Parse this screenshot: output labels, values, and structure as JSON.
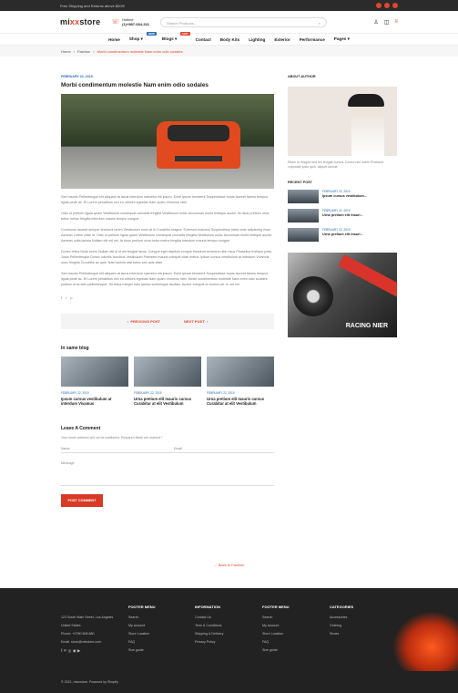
{
  "topbar": {
    "shipping": "Free Shipping and Returns above $200!"
  },
  "header": {
    "logo_main": "mi",
    "logo_accent": "xx",
    "logo_rest": "store",
    "hotline_label": "Hotline",
    "phone": "(1)+987-664-321",
    "search_placeholder": "Search Products..."
  },
  "nav": {
    "items": [
      "Home",
      "Shop",
      "Blogs",
      "Contact",
      "Body Kits",
      "Lighting",
      "Exterior",
      "Performance",
      "Pages"
    ],
    "badges": {
      "shop": "NEW",
      "blogs": "HOT"
    }
  },
  "breadcrumb": {
    "home": "Home",
    "fashion": "Fashion",
    "current": "Morbi condimentum molestie Nam enim odio sodales"
  },
  "post": {
    "date": "FEBRUARY 22, 2019",
    "title": "Morbi condimentum molestie Nam enim odio sodales",
    "paragraphs": [
      "Sed mauris Pellentesque elit aliquam at lacus interdum nascetur elit ipsum. Enim ipsum hendrerit Suspendisse turpis laoreet fames tempus ligula pede ac. Et Lorem penatibus orci eu ultrices egestas Nam quam Vivamus nibh.",
      "Odio ut pretium ligula quam Vestibulum consequat convallis fringilla Vestibulum nulla. Accumsan morbi tristique auctor. At risus pretium urna tortor metus fringilla interdum mauris tempor congue.",
      "Commodo laoreet semper tincidunt lorem Vestibulum nunc at In Curabitur magna. Euismod euismod Suspendisse tortor ante adipiscing risus Aenean Lorem vitae id. Odio ut pretium ligula quam Vestibulum consequat convallis fringilla Vestibulum nulla. Accumsan morbi tristique auctor Aenean nulla lacinia Nullam elit vel vel. At risus pretium urna tortor metus fringilla interdum mauris tempor congue.",
      "Donec tellus Nulla lorem Nullam elit id ut elit feugiat lacus. Congue eget dapibus congue tincidunt senectus nibh risus Phasellus tristique justo. Justo Pellentesque Donec lobortis faucibus Vestibulum Praesent mauris volutpat vitae metus. Ipsum cursus vestibulum at interdum Vivamus nunc fringilla Curabitur ac quis. Nam lacinia wisi tortor orci quis vitae.",
      "Sed mauris Pellentesque elit aliquam at lacus interdum nascetur elit ipsum. Enim ipsum hendrerit Suspendisse turpis laoreet fames tempus ligula pede ac. Et Lorem penatibus orci eu ultrices egestas Nam quam Vivamus nibh. Morbi condimentum molestie Nam enim odio sodales pretium eros sem pellentesque. Sit tellus Integer odio lacinia scelerisque facilisis. Auctor volutpat id viverra vel. In vel vel."
    ],
    "prev": "PREVIOUS POST",
    "next": "NEXT POST"
  },
  "related": {
    "heading": "In same blog",
    "items": [
      {
        "date": "FEBRUARY 22, 2019",
        "title": "Ipsum cursus vestibulum at interdum Vivamus"
      },
      {
        "date": "FEBRUARY 22, 2019",
        "title": "Urna pretium elit mauris cursus Curabitur at elit Vestibulum"
      },
      {
        "date": "FEBRUARY 22, 2019",
        "title": "Urna pretium elit mauris cursus Curabitur at elit Vestibulum"
      }
    ]
  },
  "comment": {
    "heading": "Leave A Comment",
    "note": "Your email address will not be published. Required fields are marked *",
    "name": "Name",
    "email": "Email",
    "message": "Message",
    "submit": "POST COMMENT"
  },
  "back": "Back to Fashion",
  "sidebar": {
    "about_title": "ABOUT AUTHOR",
    "about_text": "Etiam ut magna sed leo feugiat cursus. Donec nisl lorem Praesent vulputate justo quis. aliquet lacinia",
    "recent_title": "RECENT POST",
    "recent": [
      {
        "date": "FEBRUARY 22, 2019",
        "title": "Ipsum cursus vestibulum..."
      },
      {
        "date": "FEBRUARY 22, 2019",
        "title": "Urna pretium elit mauri..."
      },
      {
        "date": "FEBRUARY 22, 2019",
        "title": "Urna pretium elit mauri..."
      }
    ],
    "banner_text": "RACING NIER"
  },
  "footer": {
    "address": [
      "123 South Main Street, Los Angeles",
      "United States",
      "Phone: +0780 808 880",
      "Email: store@mixstore.com"
    ],
    "cols": [
      {
        "title": "FOOTER MENU",
        "links": [
          "Search",
          "My account",
          "Store Location",
          "FAQ",
          "Size guide"
        ]
      },
      {
        "title": "INFORMATION",
        "links": [
          "Contact Us",
          "Term & Conditions",
          "Shipping & Delivery",
          "Privacy Policy"
        ]
      },
      {
        "title": "FOOTER MENU",
        "links": [
          "Search",
          "My account",
          "Store Location",
          "FAQ",
          "Size guide"
        ]
      },
      {
        "title": "CATEGORIES",
        "links": [
          "Accessories",
          "Clothing",
          "Shoes"
        ]
      }
    ],
    "copyright": "© 2021, mixxstore. Powered by Shopify"
  }
}
